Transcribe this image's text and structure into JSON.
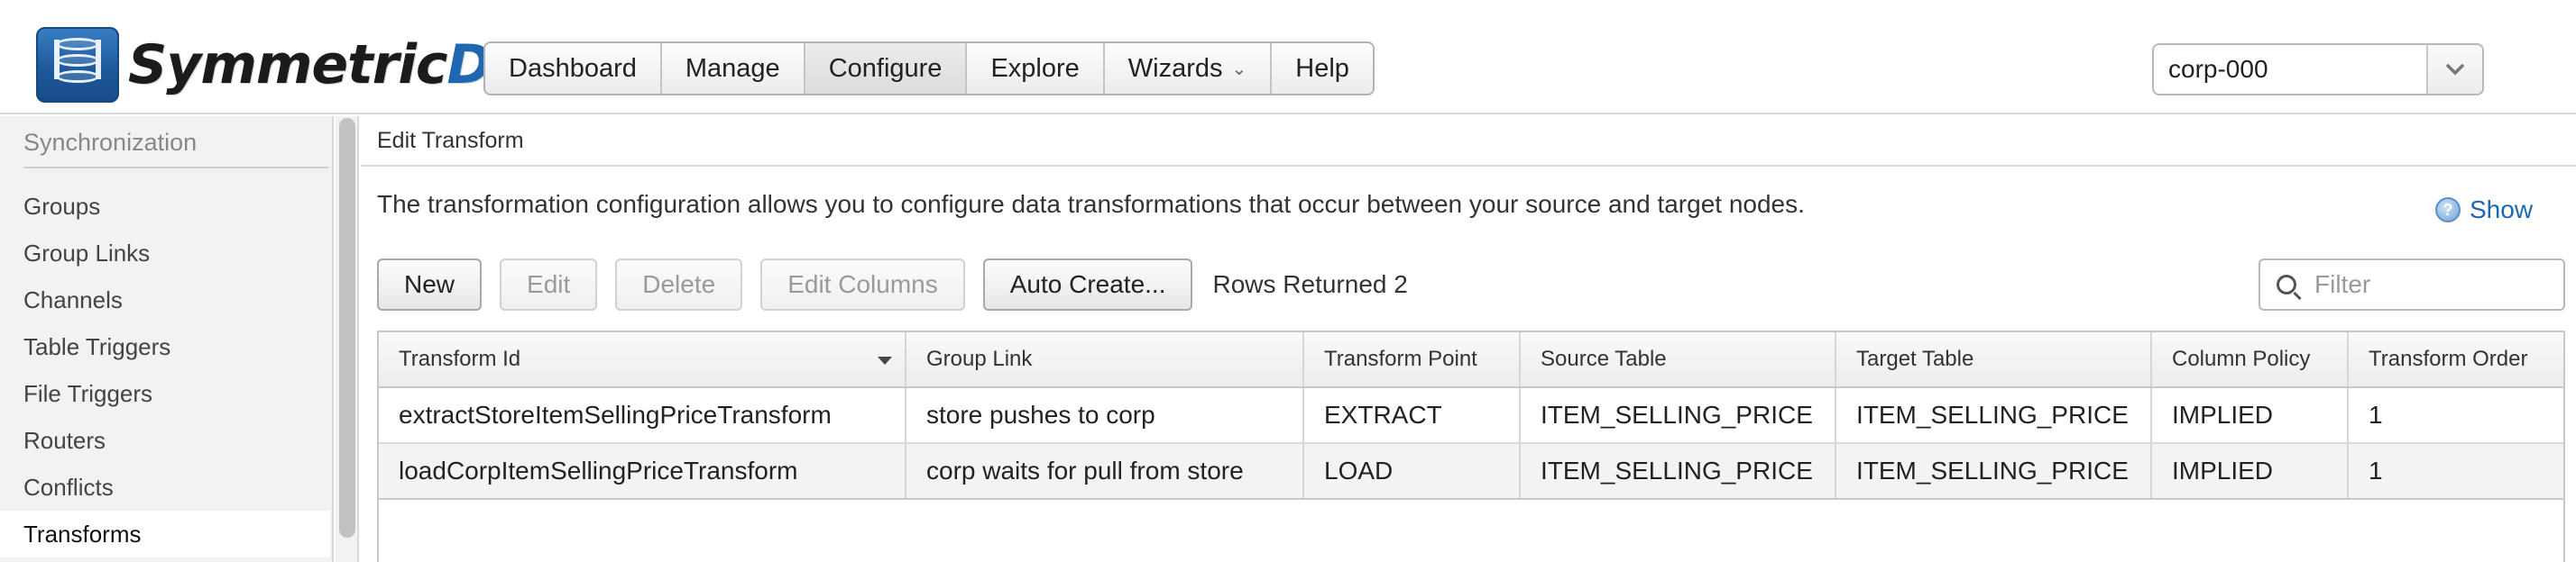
{
  "app": {
    "logo_text": "Symmetric",
    "logo_accent": "DS",
    "brand_color": "#1f67b1"
  },
  "nav": {
    "items": [
      {
        "label": "Dashboard"
      },
      {
        "label": "Manage"
      },
      {
        "label": "Configure",
        "active": true
      },
      {
        "label": "Explore"
      },
      {
        "label": "Wizards",
        "icon": "chevron-down-icon"
      },
      {
        "label": "Help"
      }
    ]
  },
  "node_selector": {
    "value": "corp-000",
    "icon": "chevron-down-icon"
  },
  "sidebar": {
    "heading": "Synchronization",
    "items": [
      {
        "label": "Groups"
      },
      {
        "label": "Group Links"
      },
      {
        "label": "Channels"
      },
      {
        "label": "Table Triggers"
      },
      {
        "label": "File Triggers"
      },
      {
        "label": "Routers"
      },
      {
        "label": "Conflicts"
      },
      {
        "label": "Transforms",
        "active": true
      }
    ]
  },
  "panel": {
    "title": "Edit Transform",
    "description": "The transformation configuration allows you to configure data transformations that occur between your source and target nodes.",
    "help_label": "Show",
    "help_icon": "help-icon"
  },
  "toolbar": {
    "new_label": "New",
    "edit_label": "Edit",
    "delete_label": "Delete",
    "edit_columns_label": "Edit Columns",
    "auto_create_label": "Auto Create...",
    "rows_returned": "Rows Returned 2",
    "filter_placeholder": "Filter",
    "filter_icon": "search-icon"
  },
  "table": {
    "columns": [
      "Transform Id",
      "Group Link",
      "Transform Point",
      "Source Table",
      "Target Table",
      "Column Policy",
      "Transform Order"
    ],
    "sorted_column": "Transform Id",
    "rows": [
      [
        "extractStoreItemSellingPriceTransform",
        "store pushes to corp",
        "EXTRACT",
        "ITEM_SELLING_PRICE",
        "ITEM_SELLING_PRICE",
        "IMPLIED",
        "1"
      ],
      [
        "loadCorpItemSellingPriceTransform",
        "corp waits for pull from store",
        "LOAD",
        "ITEM_SELLING_PRICE",
        "ITEM_SELLING_PRICE",
        "IMPLIED",
        "1"
      ]
    ]
  }
}
